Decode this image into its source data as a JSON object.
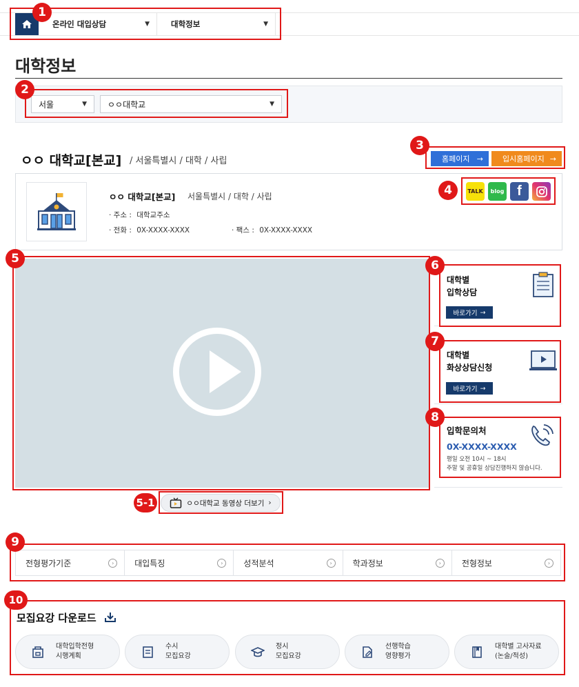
{
  "nav": {
    "menu1": "온라인 대입상담",
    "menu2": "대학정보"
  },
  "page_title": "대학정보",
  "filter": {
    "region": "서울",
    "university": "ㅇㅇ대학교"
  },
  "university": {
    "title": "ㅇㅇ 대학교[본교]",
    "subtitle": "/ 서울특별시 / 대학 / 사립",
    "name": "ㅇㅇ 대학교[본교]",
    "meta": "서울특별시 / 대학 / 사립",
    "address_label": "· 주소 :",
    "address_value": "대학교주소",
    "phone_label": "· 전화 :",
    "phone_value": "0X-XXXX-XXXX",
    "fax_label": "· 팩스 :",
    "fax_value": "0X-XXXX-XXXX"
  },
  "links": {
    "homepage": "홈페이지",
    "admission_homepage": "입시홈페이지"
  },
  "sns": {
    "kakao": "TALK",
    "blog": "blog",
    "facebook": "f",
    "instagram": ""
  },
  "side": {
    "consult_line1": "대학별",
    "consult_line2": "입학상담",
    "consult_btn": "바로가기",
    "video_line1": "대학별",
    "video_line2": "화상상담신청",
    "video_btn": "바로가기",
    "contact_title": "입학문의처",
    "contact_phone": "0X-XXXX-XXXX",
    "contact_note1": "평일 오전 10시 ~ 18시",
    "contact_note2": "주말 및 공휴일 상담진행하지 않습니다."
  },
  "video_more": "ㅇㅇ대학교 동영상 더보기",
  "tabs": [
    "전형평가기준",
    "대입특징",
    "성적분석",
    "학과정보",
    "전형정보"
  ],
  "download": {
    "title": "모집요강 다운로드",
    "items": [
      {
        "line1": "대학입학전형",
        "line2": "시행계획"
      },
      {
        "line1": "수시",
        "line2": "모집요강"
      },
      {
        "line1": "정시",
        "line2": "모집요강"
      },
      {
        "line1": "선행학습",
        "line2": "영향평가"
      },
      {
        "line1": "대학별 고사자료",
        "line2": "(논술/적성)"
      }
    ]
  },
  "markers": [
    "1",
    "2",
    "3",
    "4",
    "5",
    "5-1",
    "6",
    "7",
    "8",
    "9",
    "10"
  ],
  "colors": {
    "navy": "#163a6b",
    "blue_button": "#2f6fd8",
    "orange_button": "#f08a1d",
    "annotation_red": "#e01818"
  }
}
